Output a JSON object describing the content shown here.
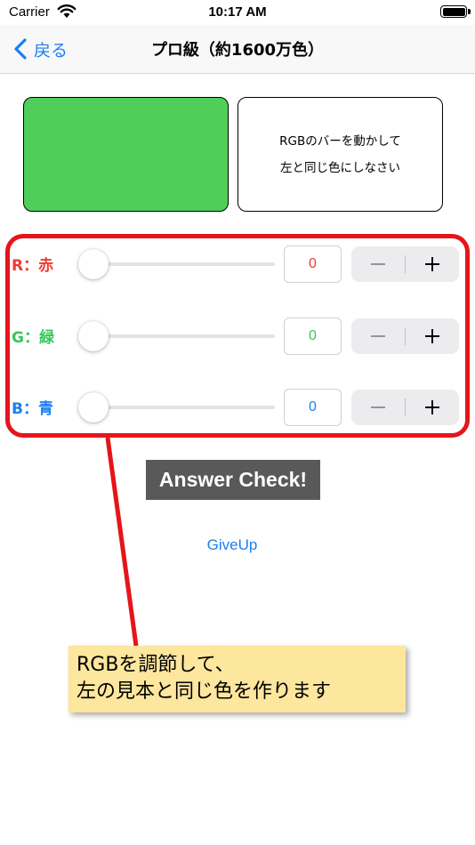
{
  "status_bar": {
    "carrier": "Carrier",
    "time": "10:17 AM"
  },
  "nav": {
    "back_label": "戻る",
    "title": "プロ級（約1600万色）"
  },
  "sample": {
    "color": "#4fcf5a"
  },
  "instruction": {
    "line1": "RGBのバーを動かして",
    "line2": "左と同じ色にしなさい"
  },
  "sliders": [
    {
      "label": "R：赤",
      "color": "#f0392e",
      "value": "0",
      "level": 0
    },
    {
      "label": "G：緑",
      "color": "#35c759",
      "value": "0",
      "level": 0
    },
    {
      "label": "B：青",
      "color": "#1a7ff2",
      "value": "0",
      "level": 0
    }
  ],
  "stepper": {
    "minus_icon": "minus-icon",
    "plus_icon": "plus-icon"
  },
  "answer_button": "Answer Check!",
  "giveup_label": "GiveUp",
  "callout": {
    "line1": "RGBを調節して、",
    "line2": "左の見本と同じ色を作ります"
  },
  "colors": {
    "accent": "#1a7ff2",
    "frame": "#e5151b",
    "callout_bg": "#fde69d"
  }
}
